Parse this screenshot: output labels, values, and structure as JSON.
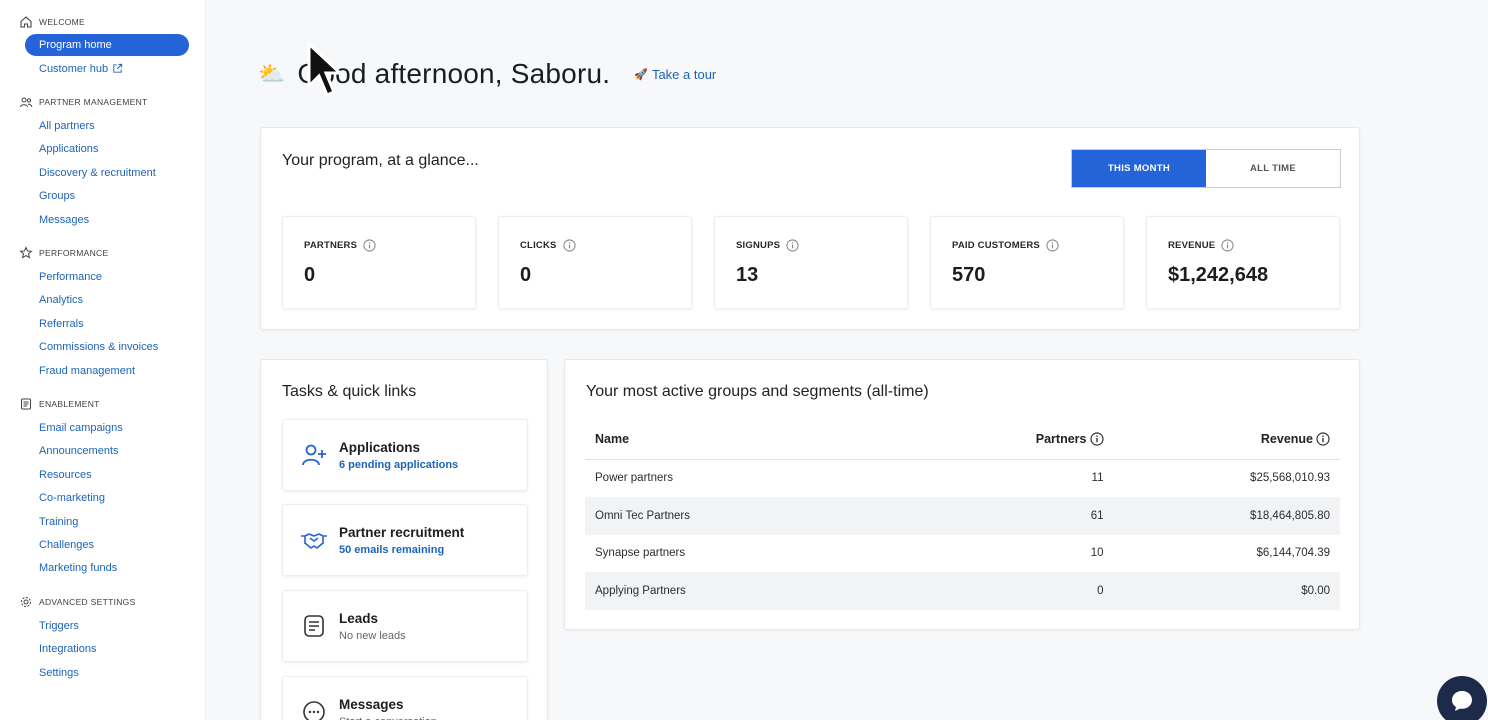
{
  "sidebar": {
    "sections": [
      {
        "title": "WELCOME",
        "icon": "home-icon",
        "items": [
          {
            "label": "Program home",
            "active": true
          },
          {
            "label": "Customer hub",
            "external": true
          }
        ]
      },
      {
        "title": "PARTNER MANAGEMENT",
        "icon": "users-icon",
        "items": [
          {
            "label": "All partners"
          },
          {
            "label": "Applications"
          },
          {
            "label": "Discovery & recruitment"
          },
          {
            "label": "Groups"
          },
          {
            "label": "Messages"
          }
        ]
      },
      {
        "title": "PERFORMANCE",
        "icon": "star-icon",
        "items": [
          {
            "label": "Performance"
          },
          {
            "label": "Analytics"
          },
          {
            "label": "Referrals"
          },
          {
            "label": "Commissions & invoices"
          },
          {
            "label": "Fraud management"
          }
        ]
      },
      {
        "title": "ENABLEMENT",
        "icon": "book-icon",
        "items": [
          {
            "label": "Email campaigns"
          },
          {
            "label": "Announcements"
          },
          {
            "label": "Resources"
          },
          {
            "label": "Co-marketing"
          },
          {
            "label": "Training"
          },
          {
            "label": "Challenges"
          },
          {
            "label": "Marketing funds"
          }
        ]
      },
      {
        "title": "ADVANCED SETTINGS",
        "icon": "gear-icon",
        "items": [
          {
            "label": "Triggers"
          },
          {
            "label": "Integrations"
          },
          {
            "label": "Settings"
          }
        ]
      }
    ]
  },
  "header": {
    "weather_icon": "⛅",
    "greeting": "Good afternoon, Saboru.",
    "tour_icon": "🚀",
    "tour_label": "Take a tour"
  },
  "glance": {
    "title": "Your program, at a glance...",
    "toggle": {
      "this_month": "THIS MONTH",
      "all_time": "ALL TIME",
      "selected": "this_month"
    },
    "stats": [
      {
        "label": "PARTNERS",
        "value": "0"
      },
      {
        "label": "CLICKS",
        "value": "0"
      },
      {
        "label": "SIGNUPS",
        "value": "13"
      },
      {
        "label": "PAID CUSTOMERS",
        "value": "570"
      },
      {
        "label": "REVENUE",
        "value": "$1,242,648"
      }
    ]
  },
  "tasks": {
    "title": "Tasks & quick links",
    "items": [
      {
        "title": "Applications",
        "subtitle": "6 pending applications",
        "icon": "add-user-icon",
        "highlight": true
      },
      {
        "title": "Partner recruitment",
        "subtitle": "50 emails remaining",
        "icon": "handshake-icon",
        "highlight": true
      },
      {
        "title": "Leads",
        "subtitle": "No new leads",
        "icon": "document-icon",
        "highlight": false
      },
      {
        "title": "Messages",
        "subtitle": "Start a conversation",
        "icon": "chat-bubble-icon",
        "highlight": false
      }
    ]
  },
  "groups": {
    "title": "Your most active groups and segments (all-time)",
    "columns": {
      "name": "Name",
      "partners": "Partners",
      "revenue": "Revenue"
    },
    "rows": [
      {
        "name": "Power partners",
        "partners": "11",
        "revenue": "$25,568,010.93"
      },
      {
        "name": "Omni Tec Partners",
        "partners": "61",
        "revenue": "$18,464,805.80"
      },
      {
        "name": "Synapse partners",
        "partners": "10",
        "revenue": "$6,144,704.39"
      },
      {
        "name": "Applying Partners",
        "partners": "0",
        "revenue": "$0.00"
      }
    ]
  }
}
